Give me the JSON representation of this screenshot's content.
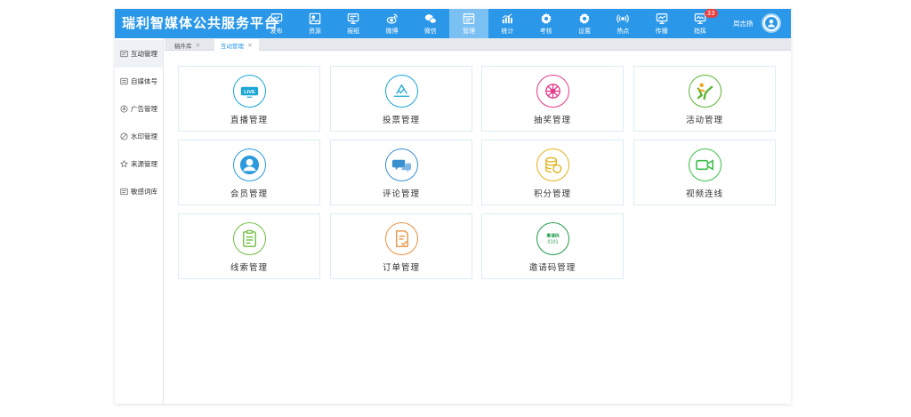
{
  "app": {
    "brand_title": "瑞利智媒体公共服务平台"
  },
  "nav": [
    {
      "label": "发布",
      "icon": "monitor-icon"
    },
    {
      "label": "资源",
      "icon": "image-icon"
    },
    {
      "label": "报纸",
      "icon": "newspaper-icon"
    },
    {
      "label": "微博",
      "icon": "weibo-icon"
    },
    {
      "label": "微信",
      "icon": "wechat-icon"
    },
    {
      "label": "管理",
      "icon": "manage-icon",
      "active": true
    },
    {
      "label": "统计",
      "icon": "bar-chart-icon"
    },
    {
      "label": "考核",
      "icon": "gear-icon"
    },
    {
      "label": "设置",
      "icon": "gear-icon"
    },
    {
      "label": "热点",
      "icon": "broadcast-icon"
    },
    {
      "label": "传播",
      "icon": "trend-icon"
    },
    {
      "label": "指挥",
      "icon": "command-icon",
      "badge": "33"
    }
  ],
  "user": {
    "name": "周志扬"
  },
  "sidebar": [
    {
      "label": "互动管理",
      "icon": "interaction-icon",
      "active": true
    },
    {
      "label": "自媒体号",
      "icon": "media-account-icon"
    },
    {
      "label": "广告管理",
      "icon": "ad-icon"
    },
    {
      "label": "水印管理",
      "icon": "watermark-icon"
    },
    {
      "label": "来源管理",
      "icon": "star-icon"
    },
    {
      "label": "敏感词库",
      "icon": "sensitive-words-icon"
    }
  ],
  "tabs": [
    {
      "label": "稿件库",
      "close": "×"
    },
    {
      "label": "互动管理",
      "close": "×",
      "active": true
    }
  ],
  "cards": [
    {
      "label": "直播管理",
      "icon": "live-icon",
      "color": "#1aa6d6"
    },
    {
      "label": "投票管理",
      "icon": "vote-icon",
      "color": "#1aa6d6"
    },
    {
      "label": "抽奖管理",
      "icon": "lottery-icon",
      "color": "#e4388a"
    },
    {
      "label": "活动管理",
      "icon": "activity-icon",
      "color": "#5cb531"
    },
    {
      "label": "会员管理",
      "icon": "member-icon",
      "color": "#2b9bdd"
    },
    {
      "label": "评论管理",
      "icon": "comment-icon",
      "color": "#3a8fcf"
    },
    {
      "label": "积分管理",
      "icon": "points-icon",
      "color": "#e2b21a"
    },
    {
      "label": "视频连线",
      "icon": "video-icon",
      "color": "#3bbf4a"
    },
    {
      "label": "线索管理",
      "icon": "clue-icon",
      "color": "#6fbf3f"
    },
    {
      "label": "订单管理",
      "icon": "order-icon",
      "color": "#e89140"
    },
    {
      "label": "邀请码管理",
      "icon": "invite-code-icon",
      "color": "#1e9a4b",
      "icon_text_1": "邀请码",
      "icon_text_2": "0101"
    }
  ],
  "live_icon_text": "LIVE"
}
